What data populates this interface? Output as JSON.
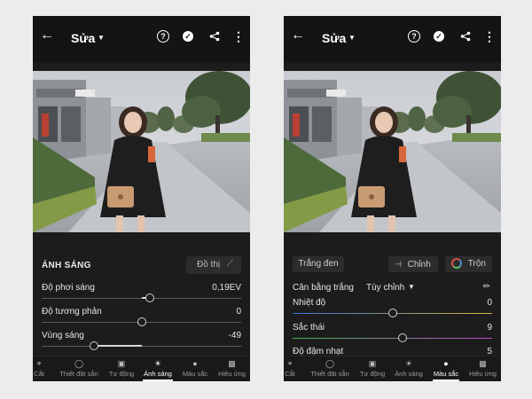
{
  "left": {
    "header": {
      "title": "Sửa"
    },
    "panel": {
      "section_title": "ÁNH SÁNG",
      "graph_label": "Đồ thị",
      "sliders": [
        {
          "label": "Độ phơi sáng",
          "value": "0,19EV",
          "level": 0.54
        },
        {
          "label": "Độ tương phản",
          "value": "0",
          "level": 0.5
        },
        {
          "label": "Vùng sáng",
          "value": "-49",
          "level": 0.26
        }
      ]
    },
    "nav": [
      "Cắt",
      "Thiết đặt sẵn",
      "Tự động",
      "Ánh sáng",
      "Màu sắc",
      "Hiệu ứng"
    ],
    "active_tab": "Ánh sáng"
  },
  "right": {
    "header": {
      "title": "Sửa"
    },
    "panel": {
      "tab_bw": "Trắng đen",
      "tab_adjust": "Chỉnh",
      "tab_mix": "Trộn",
      "wb_label": "Cân bằng trắng",
      "wb_value": "Tùy chỉnh",
      "sliders": [
        {
          "label": "Nhiệt độ",
          "value": "0",
          "level": 0.5
        },
        {
          "label": "Sắc thái",
          "value": "9",
          "level": 0.55
        },
        {
          "label": "Độ đậm nhạt",
          "value": "5",
          "level": 0.52
        }
      ]
    },
    "nav": [
      "Cắt",
      "Thiết đặt sẵn",
      "Tự động",
      "Ánh sáng",
      "Màu sắc",
      "Hiệu ứng"
    ],
    "active_tab": "Màu sắc"
  },
  "icons": {
    "back": "arrow-left-icon",
    "help": "help-icon",
    "done": "check-circle-icon",
    "share": "share-icon",
    "more": "more-vertical-icon",
    "nav": [
      "crop-icon",
      "presets-icon",
      "auto-icon",
      "light-icon",
      "color-icon",
      "effects-icon"
    ]
  },
  "colors": {
    "background": "#1c1c1c",
    "topbar": "#141414",
    "temp_gradient": [
      "#3b6fd8",
      "#d8b73b"
    ],
    "tint_gradient": [
      "#3bb34f",
      "#c54ad0"
    ]
  }
}
